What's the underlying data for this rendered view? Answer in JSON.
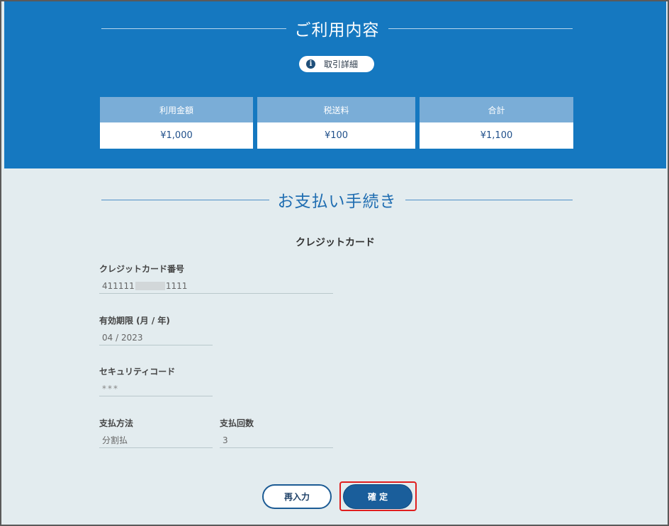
{
  "usage": {
    "title": "ご利用内容",
    "detail_button": "取引詳細",
    "cards": [
      {
        "label": "利用金額",
        "value": "¥1,000"
      },
      {
        "label": "税送料",
        "value": "¥100"
      },
      {
        "label": "合計",
        "value": "¥1,100"
      }
    ]
  },
  "payment": {
    "title": "お支払い手続き",
    "method": "クレジットカード",
    "card_number": {
      "label": "クレジットカード番号",
      "value_prefix": "411111",
      "value_suffix": "1111"
    },
    "expiry": {
      "label": "有効期限 (月 / 年)",
      "value": "04 / 2023"
    },
    "security_code": {
      "label": "セキュリティコード",
      "value": "***"
    },
    "pay_method": {
      "label": "支払方法",
      "value": "分割払"
    },
    "installments": {
      "label": "支払回数",
      "value": "3"
    }
  },
  "actions": {
    "reenter": "再入力",
    "confirm": "確 定"
  },
  "colors": {
    "brand_blue": "#1578c0",
    "card_header": "#7aadd7",
    "page_bg": "#e3ecef",
    "highlight": "#e01e1e"
  },
  "icons": {
    "detail": "info-icon"
  }
}
